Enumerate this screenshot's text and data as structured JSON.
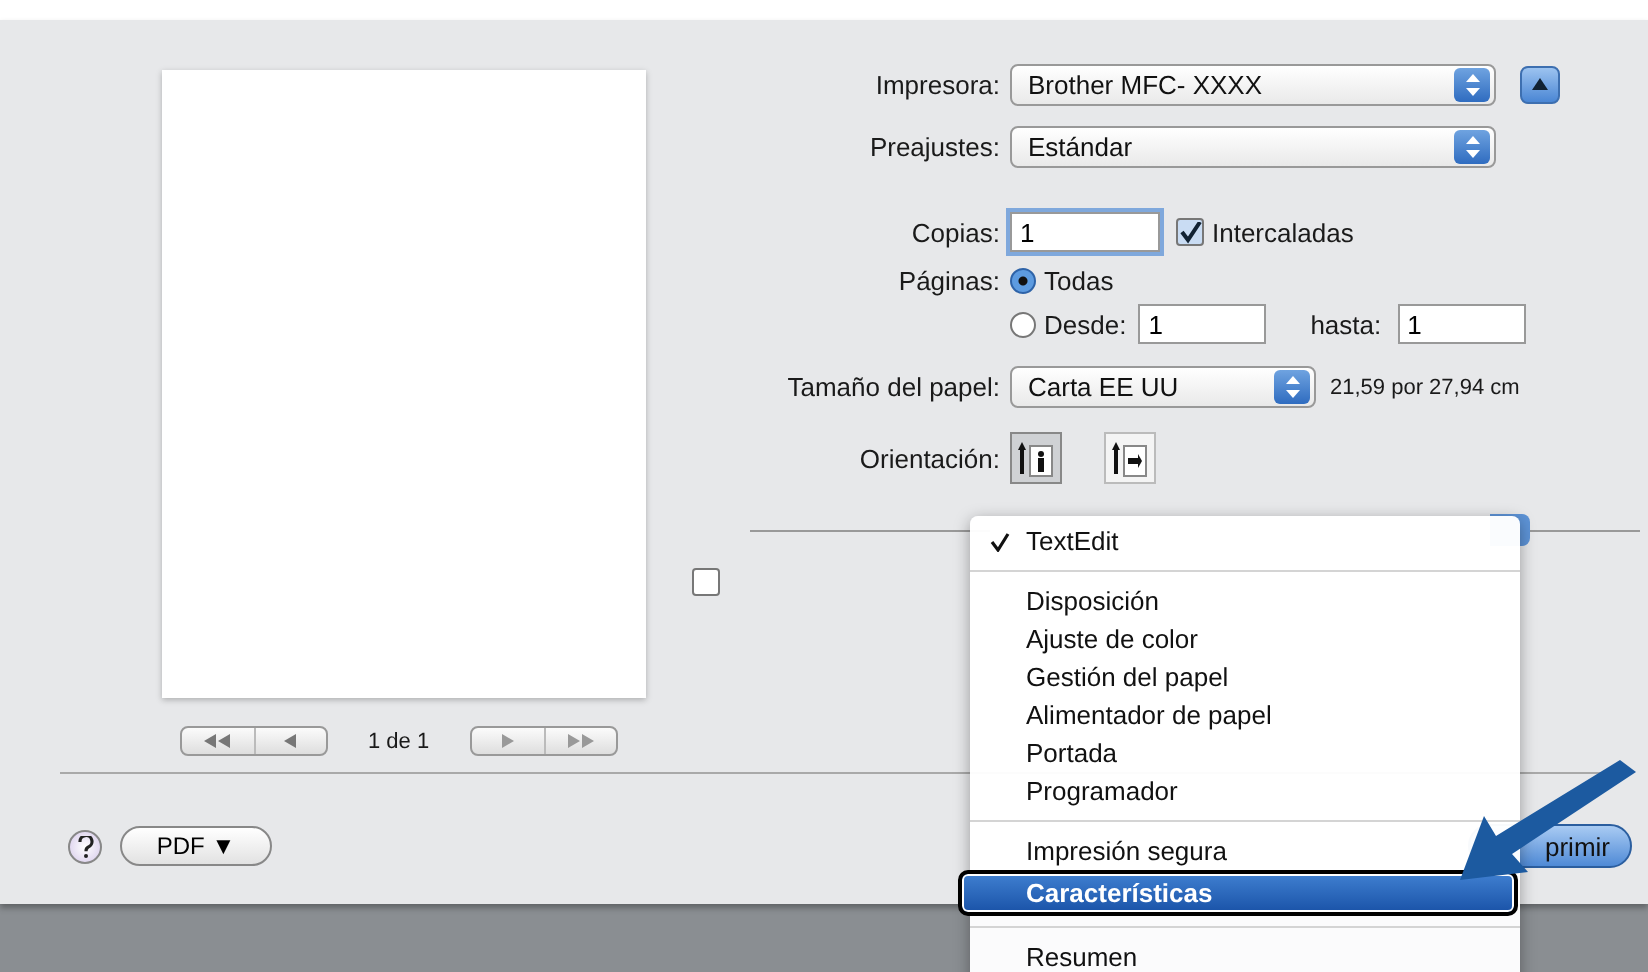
{
  "printer": {
    "label": "Impresora:",
    "value": "Brother MFC- XXXX"
  },
  "presets": {
    "label": "Preajustes:",
    "value": "Estándar"
  },
  "copies": {
    "label": "Copias:",
    "value": "1",
    "collate": {
      "label": "Intercaladas",
      "checked": true
    }
  },
  "pages": {
    "label": "Páginas:",
    "options": [
      {
        "label": "Todas",
        "selected": true
      },
      {
        "label": "Desde:",
        "selected": false
      }
    ],
    "from": "1",
    "to_label": "hasta:",
    "to": "1"
  },
  "paper_size": {
    "label": "Tamaño del papel:",
    "value": "Carta EE UU",
    "dimensions": "21,59 por 27,94 cm"
  },
  "orientation": {
    "label": "Orientación:",
    "options": [
      {
        "kind": "portrait",
        "selected": true
      },
      {
        "kind": "landscape",
        "selected": false
      }
    ]
  },
  "preview": {
    "page_indicator": "1 de 1"
  },
  "header_footer": {
    "checked": false
  },
  "pdf_button": "PDF ▼",
  "print_button": "primir",
  "menu": {
    "items": [
      {
        "kind": "item",
        "label": "TextEdit",
        "checked": true,
        "selected": false
      },
      {
        "kind": "separator"
      },
      {
        "kind": "item",
        "label": "Disposición",
        "checked": false,
        "selected": false
      },
      {
        "kind": "item",
        "label": "Ajuste de color",
        "checked": false,
        "selected": false
      },
      {
        "kind": "item",
        "label": "Gestión del papel",
        "checked": false,
        "selected": false
      },
      {
        "kind": "item",
        "label": "Alimentador de papel",
        "checked": false,
        "selected": false
      },
      {
        "kind": "item",
        "label": "Portada",
        "checked": false,
        "selected": false
      },
      {
        "kind": "item",
        "label": "Programador",
        "checked": false,
        "selected": false
      },
      {
        "kind": "separator"
      },
      {
        "kind": "item",
        "label": "Impresión segura",
        "checked": false,
        "selected": false
      },
      {
        "kind": "item",
        "label": "Características",
        "checked": false,
        "selected": true
      },
      {
        "kind": "separator"
      },
      {
        "kind": "item",
        "label": "Resumen",
        "checked": false,
        "selected": false
      }
    ]
  }
}
